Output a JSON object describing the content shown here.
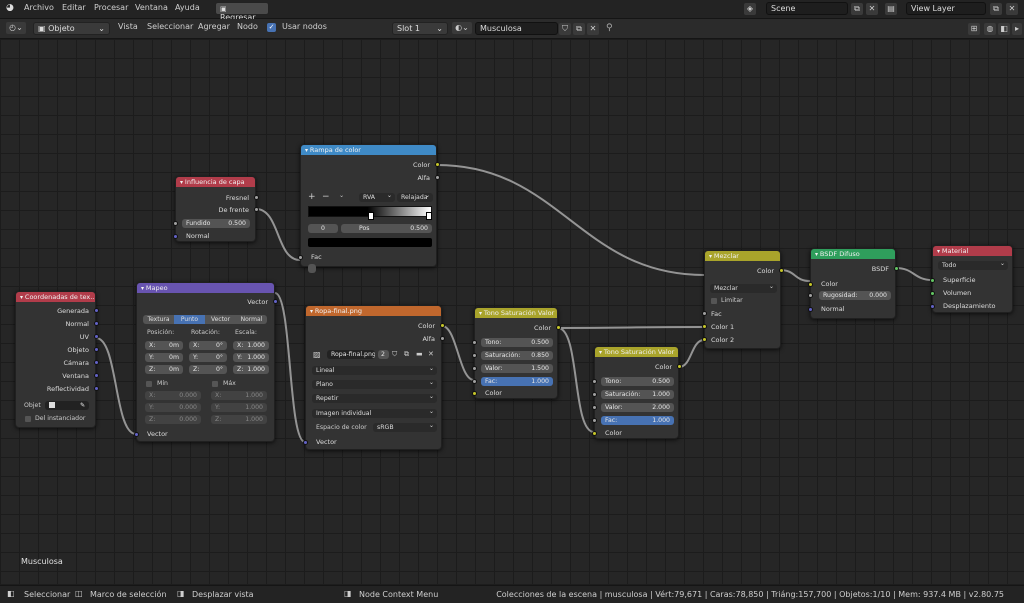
{
  "topbar": {
    "menus": [
      "Archivo",
      "Editar",
      "Procesar",
      "Ventana",
      "Ayuda"
    ],
    "regresar": "Regresar",
    "scene": "Scene",
    "view_layer": "View Layer"
  },
  "header": {
    "mode": "Objeto",
    "menus": [
      "Vista",
      "Seleccionar",
      "Agregar",
      "Nodo"
    ],
    "use_nodes": "Usar nodos",
    "slot": "Slot 1",
    "material": "Musculosa"
  },
  "overlay_material_name": "Musculosa",
  "nodes": {
    "texcoord": {
      "title": "Coordenadas de tex...",
      "outputs": [
        "Generada",
        "Normal",
        "UV",
        "Objeto",
        "Cámara",
        "Ventana",
        "Reflectividad"
      ],
      "objeto_label": "Objet",
      "from_instancer": "Del instanciador"
    },
    "mapping": {
      "title": "Mapeo",
      "out_vector": "Vector",
      "tabs": [
        "Textura",
        "Punto",
        "Vector",
        "Normal"
      ],
      "pos_label": "Posición:",
      "rot_label": "Rotación:",
      "scale_label": "Escala:",
      "pos": [
        {
          "a": "X:",
          "v": "0m"
        },
        {
          "a": "Y:",
          "v": "0m"
        },
        {
          "a": "Z:",
          "v": "0m"
        }
      ],
      "rot": [
        {
          "a": "X:",
          "v": "0°"
        },
        {
          "a": "Y:",
          "v": "0°"
        },
        {
          "a": "Z:",
          "v": "0°"
        }
      ],
      "scale": [
        {
          "a": "X:",
          "v": "1.000"
        },
        {
          "a": "Y:",
          "v": "1.000"
        },
        {
          "a": "Z:",
          "v": "1.000"
        }
      ],
      "min": "Mín",
      "max": "Máx",
      "min_vals": [
        {
          "a": "X:",
          "v": "0.000"
        },
        {
          "a": "Y:",
          "v": "0.000"
        },
        {
          "a": "Z:",
          "v": "0.000"
        }
      ],
      "max_vals": [
        {
          "a": "X:",
          "v": "1.000"
        },
        {
          "a": "Y:",
          "v": "1.000"
        },
        {
          "a": "Z:",
          "v": "1.000"
        }
      ],
      "in_vector": "Vector"
    },
    "layerweight": {
      "title": "Influencia de capa",
      "outputs": [
        "Fresnel",
        "De frente"
      ],
      "blend_label": "Fundido",
      "blend": "0.500",
      "normal": "Normal"
    },
    "colorramp": {
      "title": "Rampa de color",
      "outputs": [
        "Color",
        "Alfa"
      ],
      "color_mode": "RVA",
      "interp": "Relajada",
      "index": "0",
      "pos_label": "Pos",
      "pos": "0.500",
      "fac": "Fac"
    },
    "image": {
      "title": "Ropa-final.png",
      "outputs": [
        "Color",
        "Alfa"
      ],
      "filename": "Ropa-final.png",
      "users": "2",
      "interpolation": "Lineal",
      "projection": "Plano",
      "extension": "Repetir",
      "source": "Imagen individual",
      "colorspace_label": "Espacio de color",
      "colorspace": "sRGB",
      "in_vector": "Vector"
    },
    "hsv1": {
      "title": "Tono Saturación Valor",
      "out_color": "Color",
      "fields": [
        {
          "label": "Tono:",
          "value": "0.500"
        },
        {
          "label": "Saturación:",
          "value": "0.850"
        },
        {
          "label": "Valor:",
          "value": "1.500"
        },
        {
          "label": "Fac:",
          "value": "1.000"
        }
      ],
      "in_color": "Color"
    },
    "hsv2": {
      "title": "Tono Saturación Valor",
      "out_color": "Color",
      "fields": [
        {
          "label": "Tono:",
          "value": "0.500"
        },
        {
          "label": "Saturación:",
          "value": "1.000"
        },
        {
          "label": "Valor:",
          "value": "2.000"
        },
        {
          "label": "Fac:",
          "value": "1.000"
        }
      ],
      "in_color": "Color"
    },
    "mix": {
      "title": "Mezclar",
      "out_color": "Color",
      "blend_type": "Mezclar",
      "clamp": "Limitar",
      "inputs": [
        "Fac",
        "Color 1",
        "Color 2"
      ]
    },
    "diffuse": {
      "title": "BSDF Difuso",
      "out_bsdf": "BSDF",
      "in_color": "Color",
      "roughness_label": "Rugosidad:",
      "roughness": "0.000",
      "in_normal": "Normal"
    },
    "output": {
      "title": "Material",
      "target": "Todo",
      "inputs": [
        "Superficie",
        "Volumen",
        "Desplazamiento"
      ]
    }
  },
  "status": {
    "select": "Seleccionar",
    "box_select": "Marco de selección",
    "pan": "Desplazar vista",
    "context_menu": "Node Context Menu",
    "stats": "Colecciones de la escena | musculosa | Vért:79,671 | Caras:78,850 | Triáng:157,700 | Objetos:1/10 | Mem: 937.4 MB | v2.80.75"
  },
  "colors": {
    "input_header": "#b13c4a",
    "vector_header": "#6854b0",
    "converter_header": "#3f8ac6",
    "texture_header": "#c0672d",
    "color_header": "#a9a42b",
    "shader_header": "#2f9e5c",
    "output_header": "#b13c4a"
  }
}
